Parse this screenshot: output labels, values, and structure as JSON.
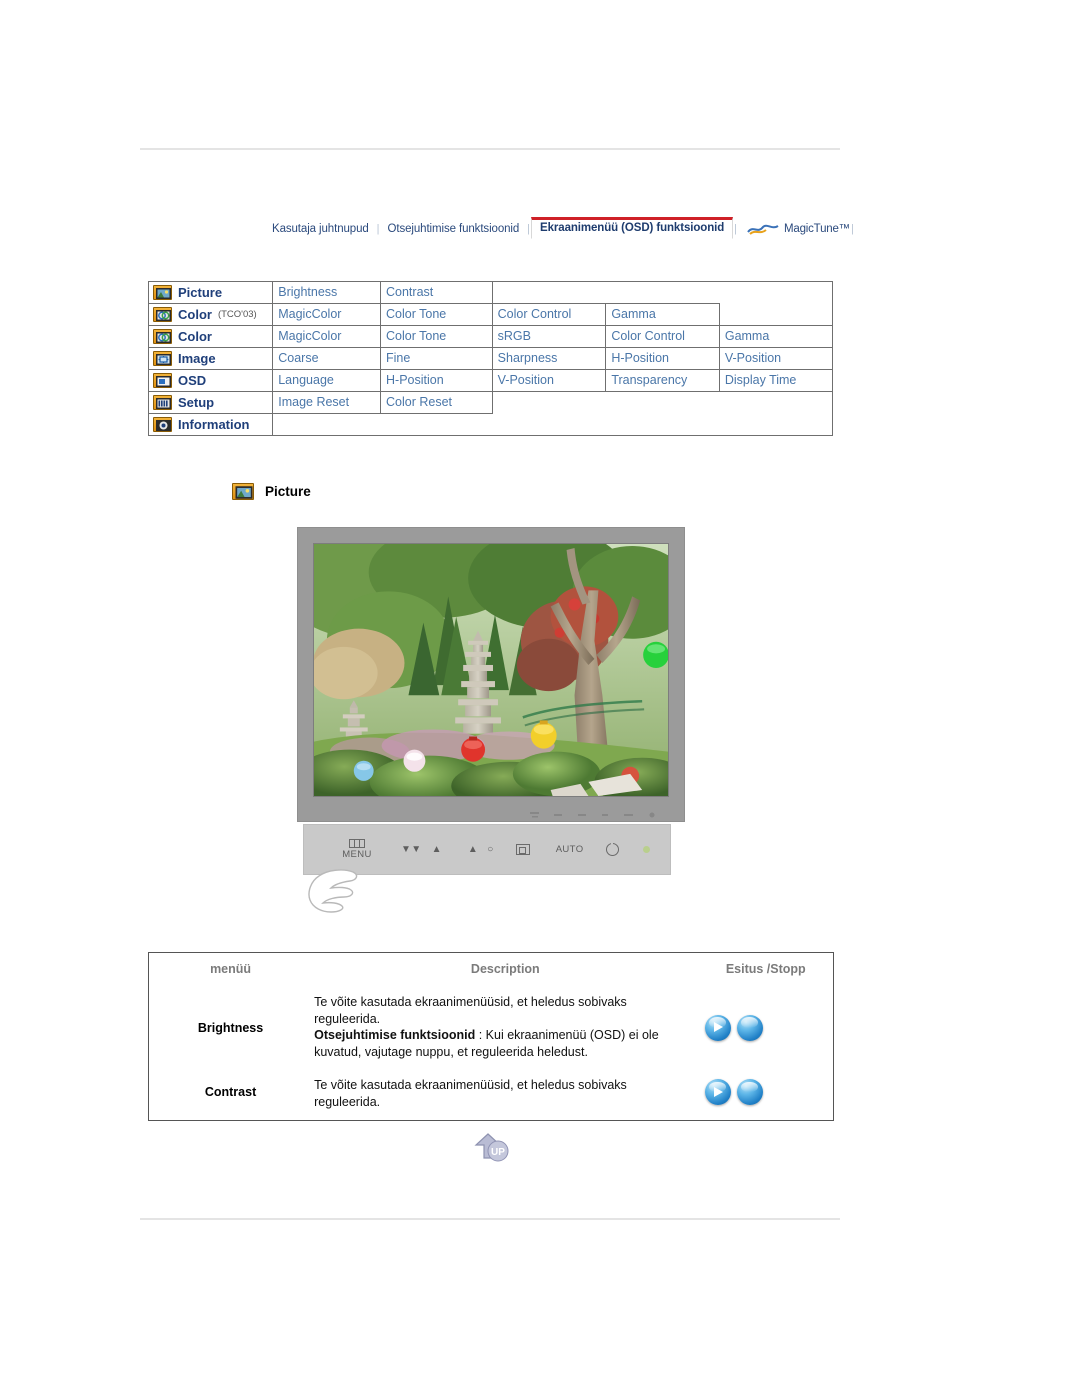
{
  "nav": {
    "items": [
      {
        "label": "Kasutaja juhtnupud",
        "active": false
      },
      {
        "label": "Otsejuhtimise funktsioonid",
        "active": false
      },
      {
        "label": "Ekraanimenüü (OSD) funktsioonid",
        "active": true
      }
    ],
    "magictune_label": "MagicTune™",
    "separator": "|",
    "logo_icon": "magictune-logo-icon",
    "active_accent_color": "#cf2027",
    "link_color": "#2b4a7d"
  },
  "menu_matrix": {
    "rows": [
      {
        "icon": "picture-icon",
        "category": "Picture",
        "category_note": "",
        "items": [
          "Brightness",
          "Contrast"
        ]
      },
      {
        "icon": "color-icon",
        "category": "Color",
        "category_note": "(TCO'03)",
        "items": [
          "MagicColor",
          "Color Tone",
          "Color Control",
          "Gamma"
        ]
      },
      {
        "icon": "color-icon",
        "category": "Color",
        "category_note": "",
        "items": [
          "MagicColor",
          "Color Tone",
          "sRGB",
          "Color Control",
          "Gamma"
        ]
      },
      {
        "icon": "image-icon",
        "category": "Image",
        "category_note": "",
        "items": [
          "Coarse",
          "Fine",
          "Sharpness",
          "H-Position",
          "V-Position"
        ]
      },
      {
        "icon": "osd-icon",
        "category": "OSD",
        "category_note": "",
        "items": [
          "Language",
          "H-Position",
          "V-Position",
          "Transparency",
          "Display Time"
        ]
      },
      {
        "icon": "setup-icon",
        "category": "Setup",
        "category_note": "",
        "items": [
          "Image Reset",
          "Color Reset"
        ]
      },
      {
        "icon": "information-icon",
        "category": "Information",
        "category_note": "",
        "items": []
      }
    ],
    "link_color": "#4a76a8",
    "category_color": "#1f3f7a"
  },
  "section": {
    "icon": "picture-icon",
    "title": "Picture"
  },
  "monitor": {
    "screen_alt": "garden-photo-with-stone-pagoda",
    "controls": {
      "menu_label": "MENU",
      "auto_label": "AUTO",
      "buttons": [
        "menu-button",
        "adjust-down-button",
        "adjust-up-button",
        "brightness-down-button",
        "brightness-up-button",
        "source-button",
        "auto-button",
        "power-button"
      ],
      "led": "power-led-indicator"
    },
    "hand_icon": "pointing-hand-icon"
  },
  "description_table": {
    "headers": {
      "menu": "menüü",
      "description": "Description",
      "play": "Esitus /Stopp"
    },
    "rows": [
      {
        "name": "Brightness",
        "lines": [
          {
            "text": "Te võite kasutada ekraanimenüüsid, et heledus sobivaks reguleerida.",
            "bold_prefix": ""
          },
          {
            "text": " : Kui ekraanimenüü (OSD) ei ole kuvatud, vajutage nuppu, et reguleerida heledust.",
            "bold_prefix": "Otsejuhtimise funktsioonid"
          }
        ],
        "buttons": [
          "play-button",
          "stop-button"
        ]
      },
      {
        "name": "Contrast",
        "lines": [
          {
            "text": "Te võite kasutada ekraanimenüüsid, et heledus sobivaks reguleerida.",
            "bold_prefix": ""
          }
        ],
        "buttons": [
          "play-button",
          "stop-button"
        ]
      }
    ]
  },
  "footer": {
    "up_label": "UP",
    "up_icon": "up-arrow-icon"
  }
}
